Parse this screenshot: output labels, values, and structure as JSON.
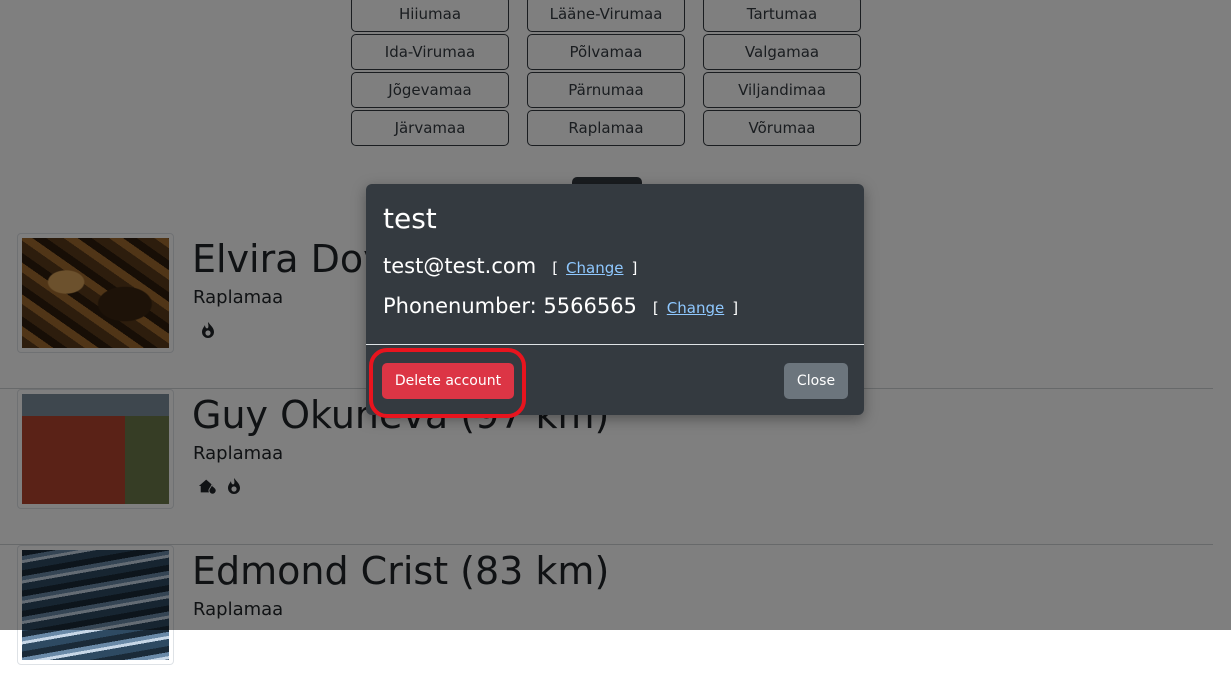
{
  "counties": [
    [
      "Hiiumaa",
      "Lääne-Virumaa",
      "Tartumaa"
    ],
    [
      "Ida-Virumaa",
      "Põlvamaa",
      "Valgamaa"
    ],
    [
      "Jõgevamaa",
      "Pärnumaa",
      "Viljandimaa"
    ],
    [
      "Järvamaa",
      "Raplamaa",
      "Võrumaa"
    ]
  ],
  "listings": [
    {
      "name": "Elvira Doyle (97 km)",
      "region": "Raplamaa",
      "tags": [
        "fire-icon"
      ]
    },
    {
      "name": "Guy Okuneva (97 km)",
      "region": "Raplamaa",
      "tags": [
        "house-fire-icon",
        "fire-icon"
      ]
    },
    {
      "name": "Edmond Crist (83 km)",
      "region": "Raplamaa",
      "tags": []
    }
  ],
  "modal": {
    "title": "test",
    "email": "test@test.com",
    "email_change_label": "Change",
    "phone_text": "Phonenumber: 5566565",
    "phone_change_label": "Change",
    "delete_label": "Delete account",
    "close_label": "Close"
  },
  "colors": {
    "modal_bg": "#343a40",
    "danger": "#dc3545",
    "secondary": "#6c757d",
    "highlight": "#e8141e",
    "link": "#8fc8ff"
  }
}
